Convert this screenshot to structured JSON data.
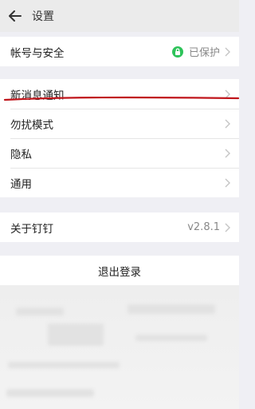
{
  "header": {
    "title": "设置",
    "back_icon": "arrow-left-icon"
  },
  "sections": {
    "account": {
      "label": "帐号与安全",
      "status": "已保护",
      "status_icon": "lock-icon",
      "status_color": "#2ec35a"
    },
    "notifications": {
      "label": "新消息通知"
    },
    "dnd": {
      "label": "勿扰模式"
    },
    "privacy": {
      "label": "隐私"
    },
    "general": {
      "label": "通用"
    },
    "about": {
      "label": "关于钉钉",
      "version": "v2.8.1"
    },
    "logout": {
      "label": "退出登录"
    }
  },
  "annotation": {
    "color": "#c0161c"
  }
}
